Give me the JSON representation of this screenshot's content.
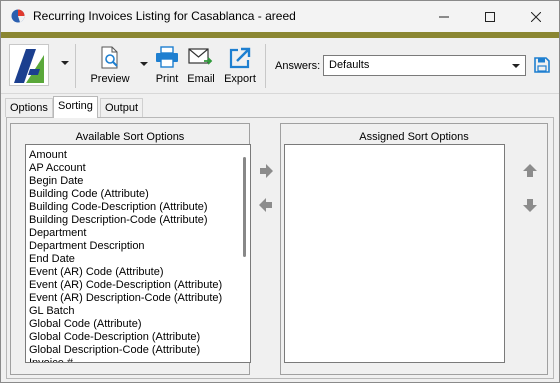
{
  "window": {
    "title": "Recurring Invoices Listing for Casablanca - areed"
  },
  "toolbar": {
    "preview_label": "Preview",
    "print_label": "Print",
    "email_label": "Email",
    "export_label": "Export",
    "answers_label": "Answers:",
    "answers_value": "Defaults"
  },
  "tabs": [
    {
      "label": "Options",
      "active": false
    },
    {
      "label": "Sorting",
      "active": true
    },
    {
      "label": "Output",
      "active": false
    }
  ],
  "available": {
    "title": "Available Sort Options",
    "items": [
      "Amount",
      "AP Account",
      "Begin Date",
      "Building Code (Attribute)",
      "Building Code-Description (Attribute)",
      "Building Description-Code (Attribute)",
      "Department",
      "Department Description",
      "End Date",
      "Event (AR) Code (Attribute)",
      "Event (AR) Code-Description (Attribute)",
      "Event (AR) Description-Code (Attribute)",
      "GL Batch",
      "Global Code (Attribute)",
      "Global Code-Description (Attribute)",
      "Global Description-Code (Attribute)",
      "Invoice #"
    ]
  },
  "assigned": {
    "title": "Assigned Sort Options",
    "items": []
  },
  "colors": {
    "accent_bar": "#8a8632",
    "logo_blue": "#1b3f8f",
    "logo_green": "#5aa83a",
    "icon_blue": "#1e7fd0"
  },
  "icons": {
    "app": "pie-chart-icon",
    "preview": "magnifier-document-icon",
    "print": "printer-icon",
    "email": "envelope-icon",
    "export": "export-arrow-icon",
    "save": "floppy-disk-icon",
    "move_right": "arrow-right-icon",
    "move_left": "arrow-left-icon",
    "move_up": "arrow-up-icon",
    "move_down": "arrow-down-icon"
  }
}
